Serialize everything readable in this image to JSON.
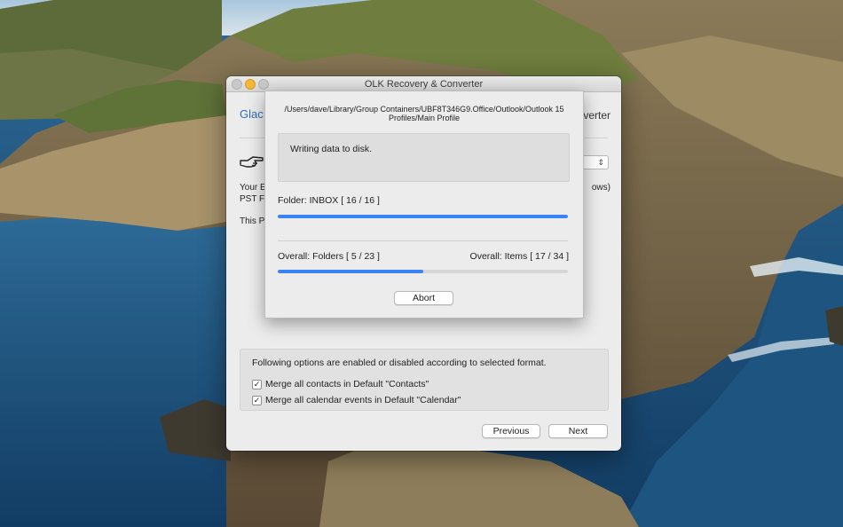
{
  "window": {
    "title": "OLK Recovery & Converter",
    "brand_left": "Glac",
    "brand_right": "verter",
    "desc_line1": "Your E",
    "desc_line2": "PST Fi",
    "desc_right": "ows)",
    "desc_line3": "This P"
  },
  "options": {
    "heading": "Following options are enabled or disabled according to selected format.",
    "items": [
      {
        "label": "Merge all contacts in Default \"Contacts\"",
        "checked": "✓"
      },
      {
        "label": "Merge all calendar events in Default \"Calendar\"",
        "checked": "✓"
      }
    ]
  },
  "buttons": {
    "previous": "Previous",
    "next": "Next",
    "abort": "Abort"
  },
  "progress_sheet": {
    "path_line1": "/Users/dave/Library/Group Containers/UBF8T346G9.Office/Outlook/Outlook 15",
    "path_line2": "Profiles/Main Profile",
    "status": "Writing data to disk.",
    "folder_label": "Folder: INBOX [ 16 / 16 ]",
    "folder_progress": 1.0,
    "overall_folders_label": "Overall: Folders [ 5 / 23 ]",
    "overall_items_label": "Overall: Items [ 17 / 34 ]",
    "overall_progress": 0.5
  },
  "colors": {
    "accent": "#3a82f7",
    "brand": "#2f6fb8",
    "minimize": "#f5b73a"
  },
  "icons": {
    "hand": "pointing-hand-icon",
    "select": "up-down-chevron-icon"
  }
}
